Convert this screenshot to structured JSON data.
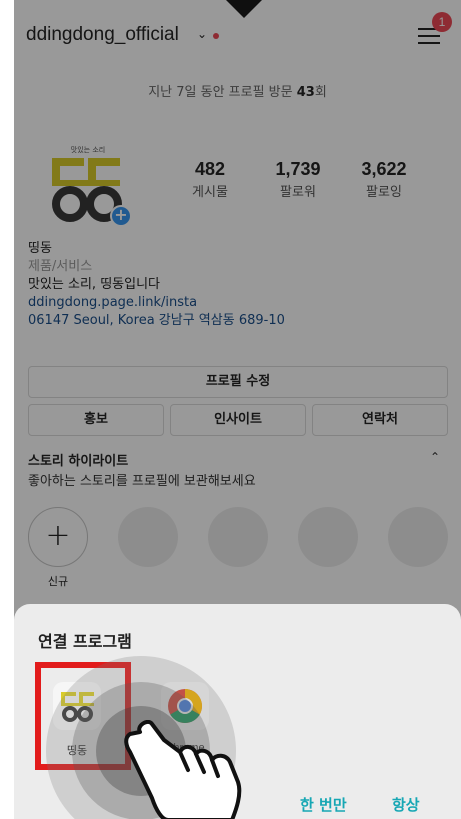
{
  "profile": {
    "username": "ddingdong_official",
    "menu_badge": "1",
    "visits_prefix": "지난 7일 동안 프로필 방문 ",
    "visits_count": "43",
    "visits_suffix": "회",
    "logo_small_text": "맛있는 소리",
    "stats": [
      {
        "value": "482",
        "label": "게시물"
      },
      {
        "value": "1,739",
        "label": "팔로워"
      },
      {
        "value": "3,622",
        "label": "팔로잉"
      }
    ],
    "name": "띵동",
    "category": "제품/서비스",
    "bio": "맛있는 소리, 띵동입니다",
    "link": "ddingdong.page.link/insta",
    "address": "06147 Seoul, Korea 강남구 역삼동 689-10"
  },
  "buttons": {
    "edit_profile": "프로필 수정",
    "promote": "홍보",
    "insights": "인사이트",
    "contact": "연락처"
  },
  "highlights": {
    "title": "스토리 하이라이트",
    "subtitle": "좋아하는 스토리를 프로필에 보관해보세요",
    "new_label": "신규"
  },
  "sheet": {
    "title": "연결 프로그램",
    "apps": [
      {
        "label": "띵동",
        "icon": "ddingdong-app-icon"
      },
      {
        "label": "Chrome",
        "icon": "chrome-icon"
      }
    ],
    "once": "한 번만",
    "always": "항상"
  },
  "colors": {
    "accent": "#17a7b4",
    "highlight_box": "#e21b1b",
    "notification": "#ed4956",
    "brand_yellow": "#d9cc2b"
  }
}
